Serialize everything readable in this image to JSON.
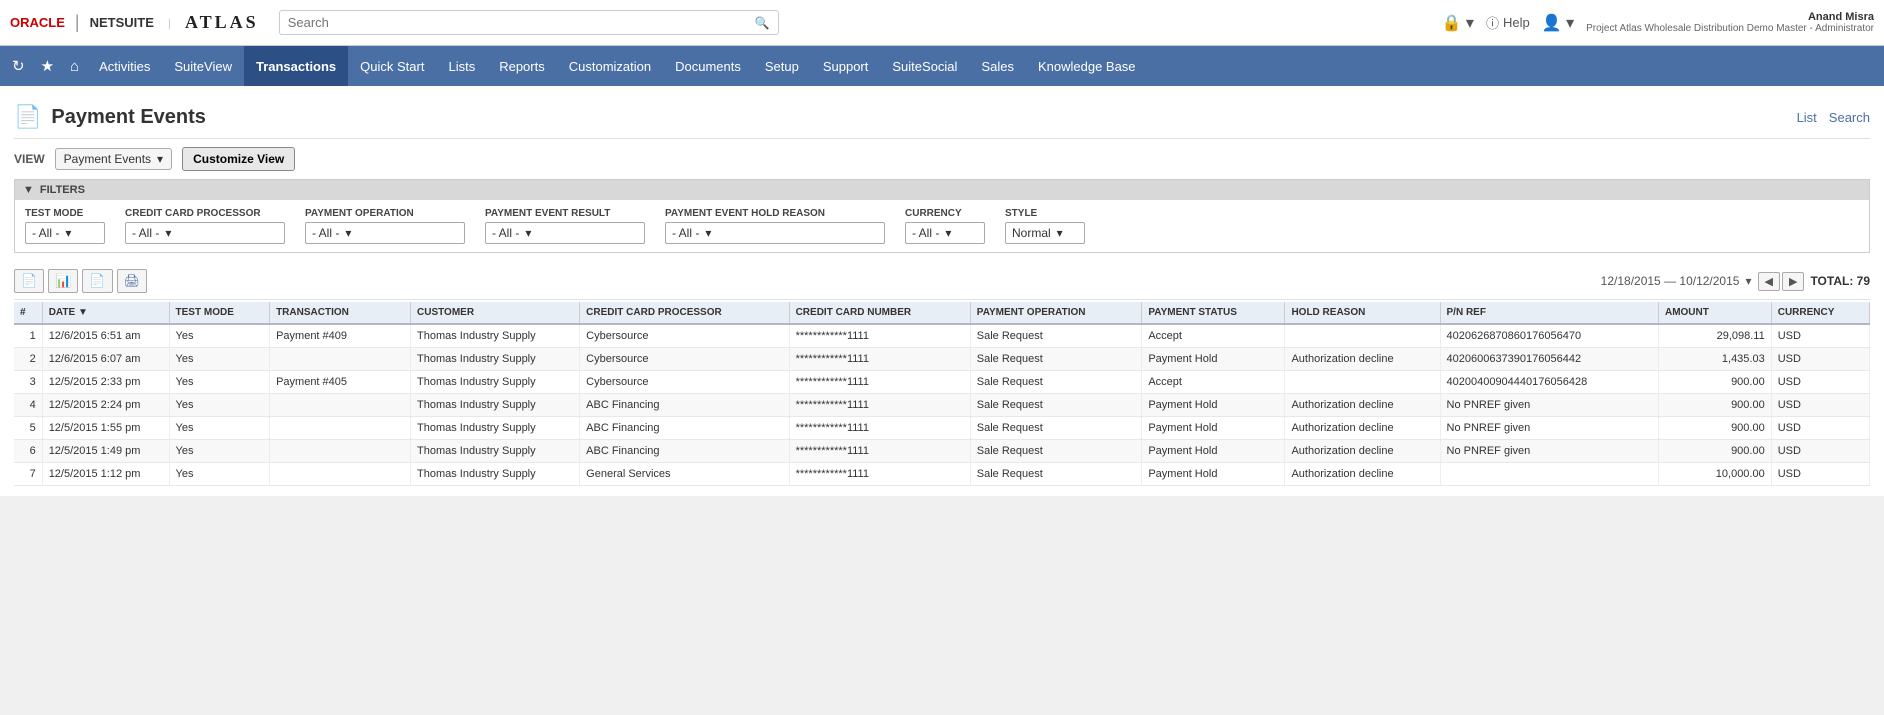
{
  "app": {
    "oracle_label": "ORACLE",
    "netsuite_label": "NETSUITE",
    "divider": "|",
    "atlas_label": "ATLAS",
    "search_placeholder": "Search"
  },
  "topbar": {
    "help_label": "Help",
    "user_name": "Anand Misra",
    "user_role": "Project Atlas Wholesale Distribution Demo Master - Administrator"
  },
  "nav": {
    "items": [
      {
        "label": "Activities",
        "active": false
      },
      {
        "label": "SuiteView",
        "active": false
      },
      {
        "label": "Transactions",
        "active": true
      },
      {
        "label": "Quick Start",
        "active": false
      },
      {
        "label": "Lists",
        "active": false
      },
      {
        "label": "Reports",
        "active": false
      },
      {
        "label": "Customization",
        "active": false
      },
      {
        "label": "Documents",
        "active": false
      },
      {
        "label": "Setup",
        "active": false
      },
      {
        "label": "Support",
        "active": false
      },
      {
        "label": "SuiteSocial",
        "active": false
      },
      {
        "label": "Sales",
        "active": false
      },
      {
        "label": "Knowledge Base",
        "active": false
      }
    ]
  },
  "page": {
    "title": "Payment Events",
    "list_label": "List",
    "search_label": "Search"
  },
  "view": {
    "label": "VIEW",
    "current": "Payment Events",
    "customize_label": "Customize View"
  },
  "filters": {
    "header": "FILTERS",
    "test_mode": {
      "label": "TEST MODE",
      "value": "- All -"
    },
    "credit_card_processor": {
      "label": "CREDIT CARD PROCESSOR",
      "value": "- All -"
    },
    "payment_operation": {
      "label": "PAYMENT OPERATION",
      "value": "- All -"
    },
    "payment_event_result": {
      "label": "PAYMENT EVENT RESULT",
      "value": "- All -"
    },
    "payment_event_hold_reason": {
      "label": "PAYMENT EVENT HOLD REASON",
      "value": "- All -"
    },
    "currency": {
      "label": "CURRENCY",
      "value": "- All -"
    },
    "style": {
      "label": "STYLE",
      "value": "Normal"
    }
  },
  "toolbar": {
    "date_range": "12/18/2015 — 10/12/2015",
    "total_label": "TOTAL: 79"
  },
  "table": {
    "columns": [
      {
        "key": "num",
        "label": "#"
      },
      {
        "key": "date",
        "label": "DATE ▼"
      },
      {
        "key": "testmode",
        "label": "TEST MODE"
      },
      {
        "key": "transaction",
        "label": "TRANSACTION"
      },
      {
        "key": "customer",
        "label": "CUSTOMER"
      },
      {
        "key": "processor",
        "label": "CREDIT CARD PROCESSOR"
      },
      {
        "key": "ccnum",
        "label": "CREDIT CARD NUMBER"
      },
      {
        "key": "payop",
        "label": "PAYMENT OPERATION"
      },
      {
        "key": "paystatus",
        "label": "PAYMENT STATUS"
      },
      {
        "key": "holdreason",
        "label": "HOLD REASON"
      },
      {
        "key": "pnref",
        "label": "P/N REF"
      },
      {
        "key": "amount",
        "label": "AMOUNT"
      },
      {
        "key": "currency",
        "label": "CURRENCY"
      }
    ],
    "rows": [
      {
        "num": "1",
        "date": "12/6/2015 6:51 am",
        "testmode": "Yes",
        "transaction": "Payment #409",
        "transaction_link": true,
        "customer": "Thomas Industry Supply",
        "processor": "Cybersource",
        "ccnum": "************1111",
        "payop": "Sale Request",
        "paystatus": "Accept",
        "holdreason": "",
        "pnref": "402062687086017​6056470",
        "amount": "29,098.11",
        "currency": "USD"
      },
      {
        "num": "2",
        "date": "12/6/2015 6:07 am",
        "testmode": "Yes",
        "transaction": "",
        "transaction_link": false,
        "customer": "Thomas Industry Supply",
        "processor": "Cybersource",
        "ccnum": "************1111",
        "payop": "Sale Request",
        "paystatus": "Payment Hold",
        "holdreason": "Authorization decline",
        "pnref": "402060063​7390176056442",
        "amount": "1,435.03",
        "currency": "USD"
      },
      {
        "num": "3",
        "date": "12/5/2015 2:33 pm",
        "testmode": "Yes",
        "transaction": "Payment #405",
        "transaction_link": true,
        "customer": "Thomas Industry Supply",
        "processor": "Cybersource",
        "ccnum": "************1111",
        "payop": "Sale Request",
        "paystatus": "Accept",
        "holdreason": "",
        "pnref": "402004009044​40176056428",
        "amount": "900.00",
        "currency": "USD"
      },
      {
        "num": "4",
        "date": "12/5/2015 2:24 pm",
        "testmode": "Yes",
        "transaction": "",
        "transaction_link": false,
        "customer": "Thomas Industry Supply",
        "processor": "ABC Financing",
        "ccnum": "************1111",
        "payop": "Sale Request",
        "paystatus": "Payment Hold",
        "holdreason": "Authorization decline",
        "pnref": "No PNREF given",
        "amount": "900.00",
        "currency": "USD"
      },
      {
        "num": "5",
        "date": "12/5/2015 1:55 pm",
        "testmode": "Yes",
        "transaction": "",
        "transaction_link": false,
        "customer": "Thomas Industry Supply",
        "processor": "ABC Financing",
        "ccnum": "************1111",
        "payop": "Sale Request",
        "paystatus": "Payment Hold",
        "holdreason": "Authorization decline",
        "pnref": "No PNREF given",
        "amount": "900.00",
        "currency": "USD"
      },
      {
        "num": "6",
        "date": "12/5/2015 1:49 pm",
        "testmode": "Yes",
        "transaction": "",
        "transaction_link": false,
        "customer": "Thomas Industry Supply",
        "processor": "ABC Financing",
        "ccnum": "************1111",
        "payop": "Sale Request",
        "paystatus": "Payment Hold",
        "holdreason": "Authorization decline",
        "pnref": "No PNREF given",
        "amount": "900.00",
        "currency": "USD"
      },
      {
        "num": "7",
        "date": "12/5/2015 1:12 pm",
        "testmode": "Yes",
        "transaction": "",
        "transaction_link": false,
        "customer": "Thomas Industry Supply",
        "processor": "General Services",
        "ccnum": "************1111",
        "payop": "Sale Request",
        "paystatus": "Payment Hold",
        "holdreason": "Authorization decline",
        "pnref": "",
        "amount": "10,000.00",
        "currency": "USD"
      }
    ]
  }
}
